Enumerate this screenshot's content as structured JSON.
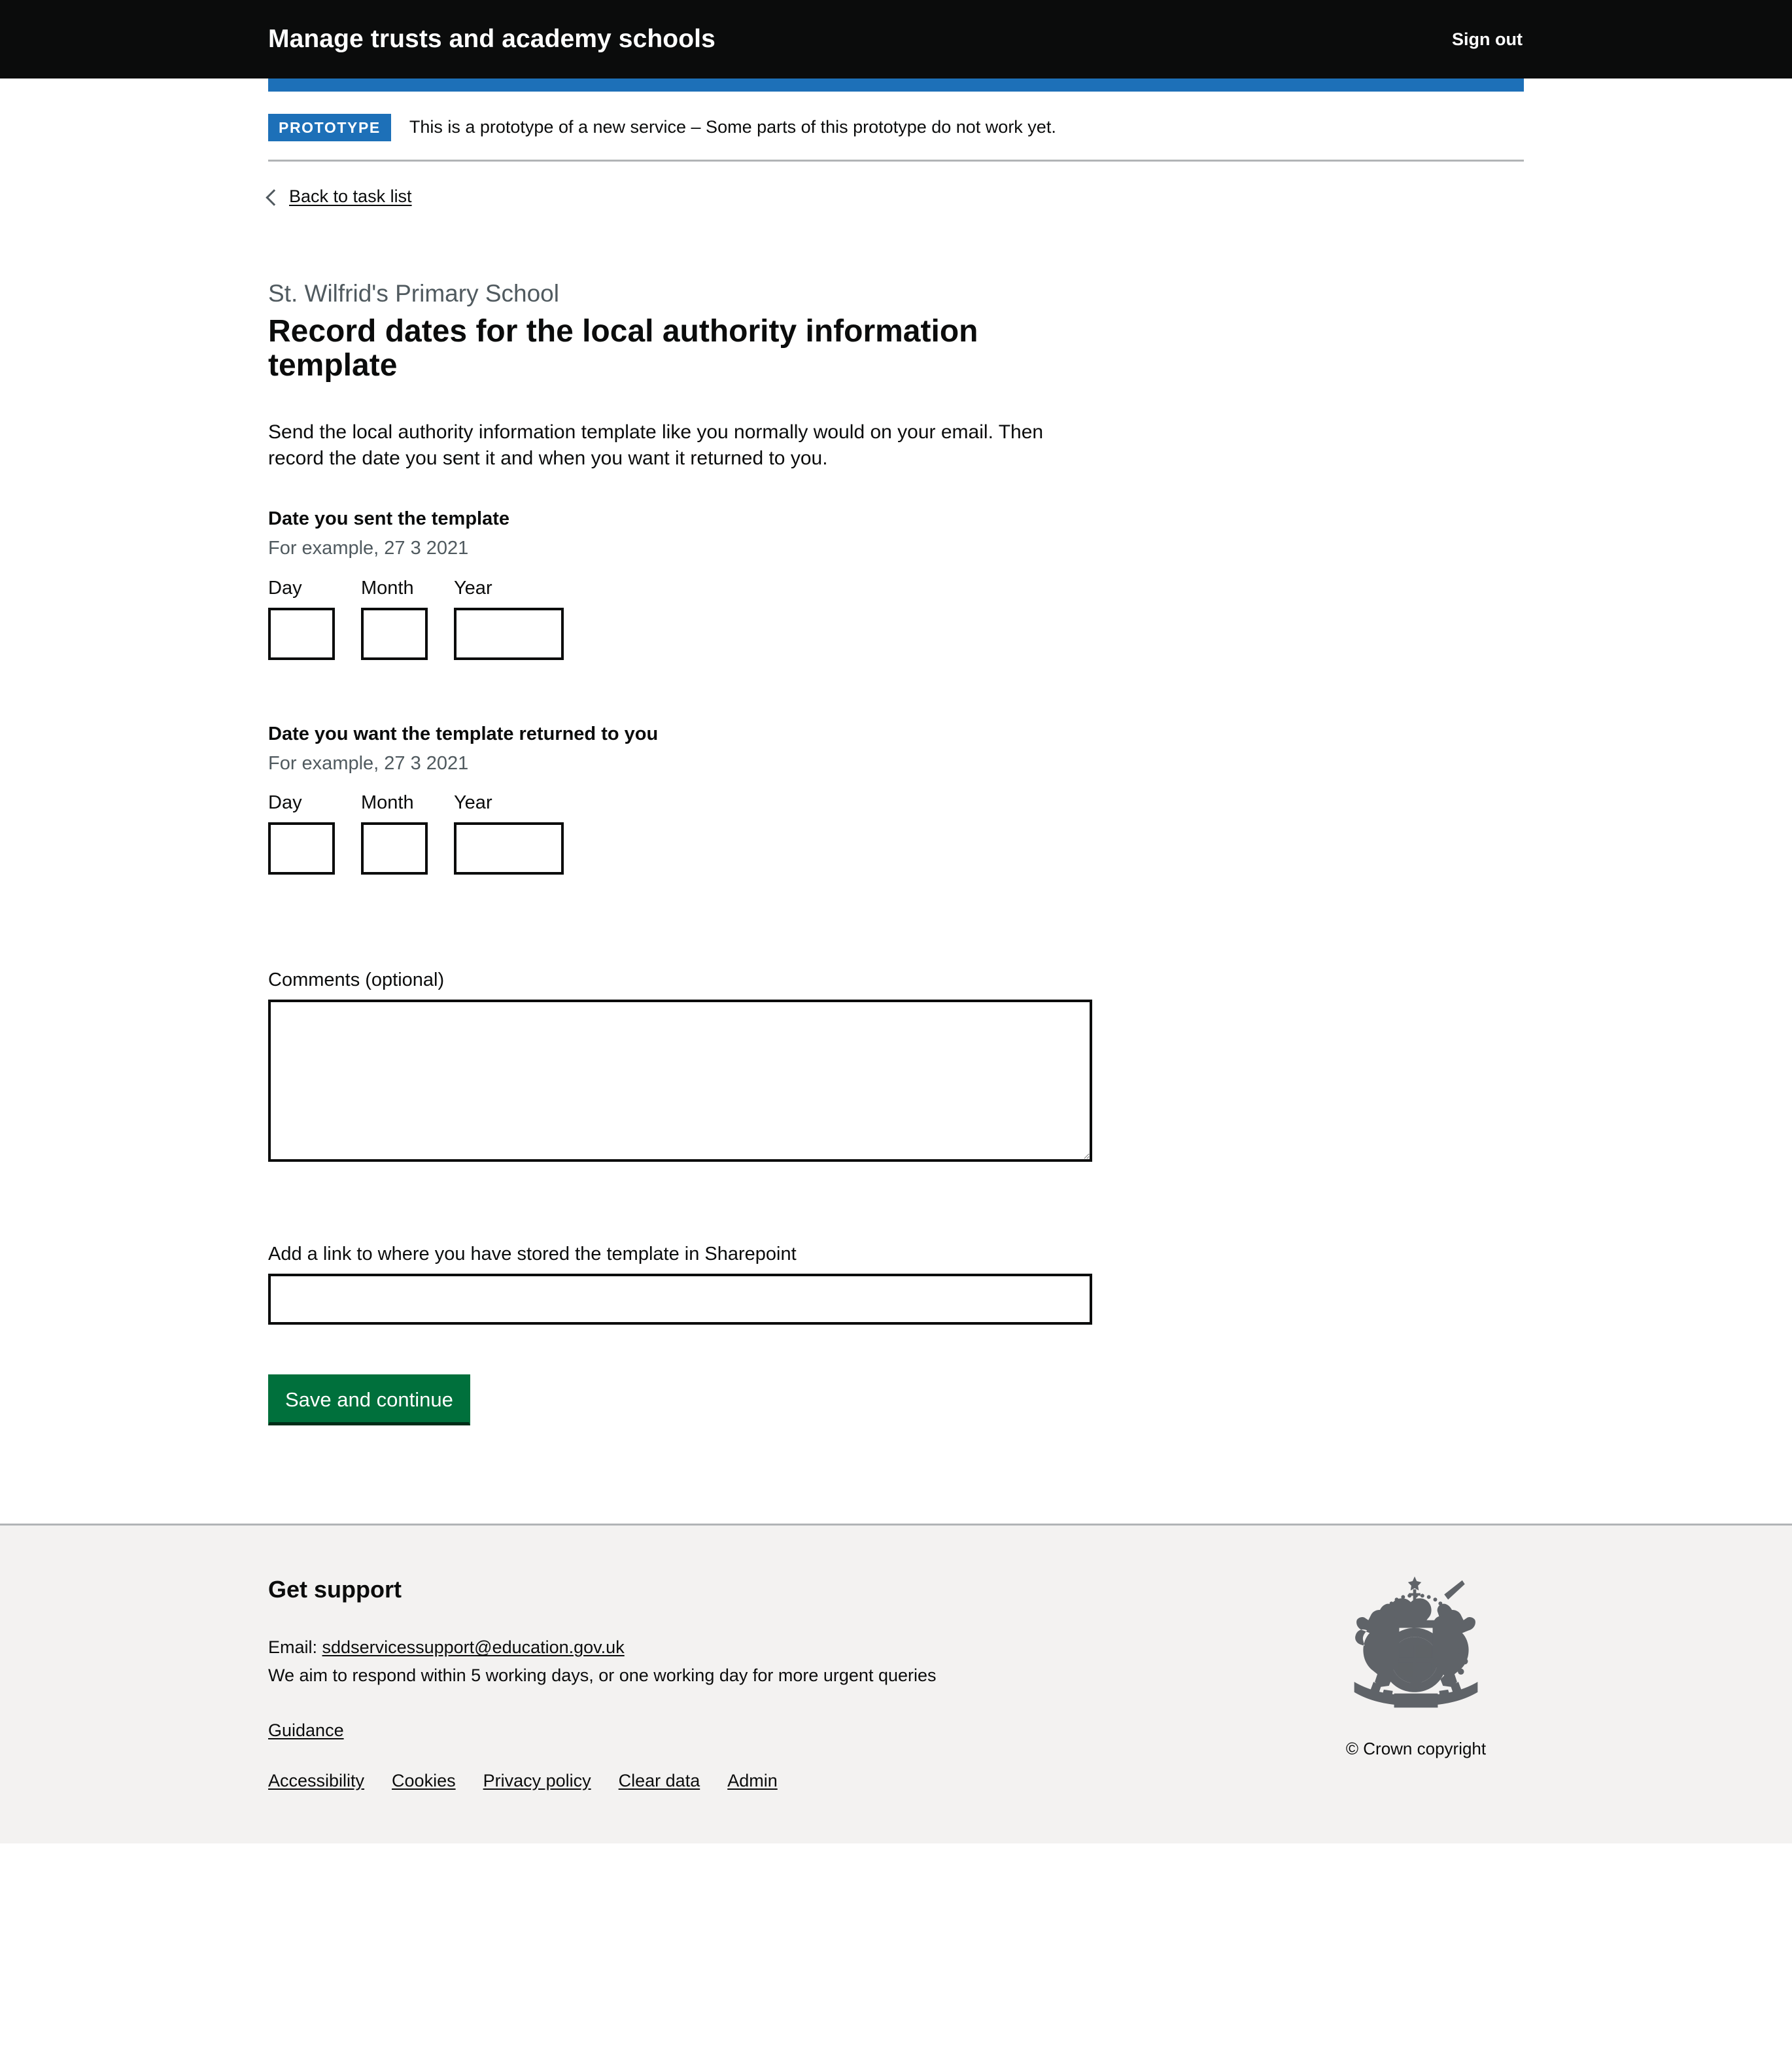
{
  "header": {
    "service_name": "Manage trusts and academy schools",
    "sign_out_label": "Sign out",
    "accent_color": "#1d70b8",
    "background_color": "#0b0c0c"
  },
  "phase_banner": {
    "tag": "PROTOTYPE",
    "text": "This is a prototype of a new service – Some parts of this prototype do not work yet."
  },
  "back_link": {
    "label": "Back to task list"
  },
  "main": {
    "caption": "St. Wilfrid's Primary School",
    "heading": "Record dates for the local authority information template",
    "intro": "Send the local authority information template like you normally would on your email. Then record the date you sent it and when you want it returned to you.",
    "date_sent": {
      "legend": "Date you sent the template",
      "hint": "For example, 27 3 2021",
      "day_label": "Day",
      "month_label": "Month",
      "year_label": "Year",
      "day_value": "",
      "month_value": "",
      "year_value": ""
    },
    "date_returned": {
      "legend": "Date you want the template returned to you",
      "hint": "For example, 27 3 2021",
      "day_label": "Day",
      "month_label": "Month",
      "year_label": "Year",
      "day_value": "",
      "month_value": "",
      "year_value": ""
    },
    "comments": {
      "label": "Comments (optional)",
      "value": ""
    },
    "sharepoint_link": {
      "label": "Add a link to where you have stored the template in Sharepoint",
      "value": ""
    },
    "submit_label": "Save and continue",
    "submit_color": "#00703c"
  },
  "footer": {
    "heading": "Get support",
    "email_prefix": "Email:",
    "email_address": "sddservicessupport@education.gov.uk",
    "response_time": "We aim to respond within 5 working days, or one working day for more urgent queries",
    "guidance_label": "Guidance",
    "meta_links": [
      {
        "label": "Accessibility"
      },
      {
        "label": "Cookies"
      },
      {
        "label": "Privacy policy"
      },
      {
        "label": "Clear data"
      },
      {
        "label": "Admin"
      }
    ],
    "copyright": "© Crown copyright",
    "background_color": "#f3f2f1"
  }
}
